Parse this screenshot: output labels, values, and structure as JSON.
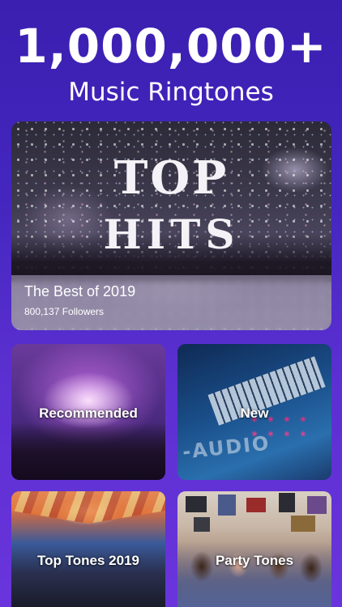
{
  "header": {
    "headline": "1,000,000+",
    "subline": "Music Ringtones"
  },
  "hero": {
    "art_line1": "TOP",
    "art_line2": "HITS",
    "title": "The Best of 2019",
    "followers": "800,137 Followers"
  },
  "categories": [
    {
      "label": "Recommended"
    },
    {
      "label": "New"
    },
    {
      "label": "Top Tones 2019"
    },
    {
      "label": "Party Tones"
    }
  ],
  "new_card": {
    "device_brand": "-AUDIO"
  },
  "colors": {
    "background_top": "#3a1fb0",
    "background_bottom": "#6a34dc",
    "text": "#ffffff"
  }
}
